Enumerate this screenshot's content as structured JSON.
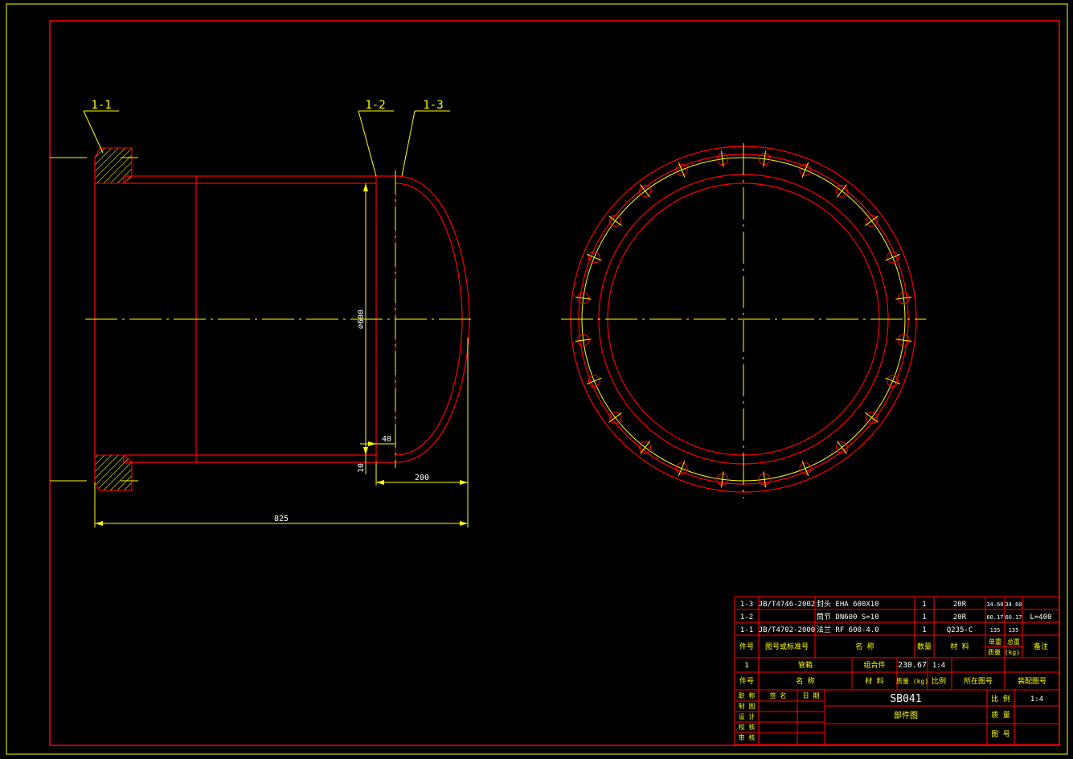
{
  "colors": {
    "outline": "#ff0000",
    "centerline": "#ffff00",
    "dimension": "#ffffff",
    "hatch": "#ffff00",
    "background": "#000000"
  },
  "labels": {
    "p1": "1-1",
    "p2": "1-2",
    "p3": "1-3"
  },
  "dims": {
    "d_600": "∅600",
    "d_40": "40",
    "d_10": "10",
    "d_200": "200",
    "d_825": "825"
  },
  "flange_bolt_count": 24,
  "bom": {
    "rows": [
      {
        "no": "1-3",
        "std": "JB/T4746-2002",
        "name": "封头 EHA 600X10",
        "qty": "1",
        "mat": "20R",
        "w1": "34.60",
        "w2": "34.60",
        "note": ""
      },
      {
        "no": "1-2",
        "std": "",
        "name": "筒节 DN600 S=10",
        "qty": "1",
        "mat": "20R",
        "w1": "60.17",
        "w2": "60.17",
        "note": "L=400"
      },
      {
        "no": "1-1",
        "std": "JB/T4702-2000",
        "name": "法兰 RF 600-4.0",
        "qty": "1",
        "mat": "Q235-C",
        "w1": "135",
        "w2": "135",
        "note": ""
      }
    ],
    "header": {
      "no": "件号",
      "std": "图号或标准号",
      "name": "名   称",
      "qty": "数量",
      "mat": "材 料",
      "w_single": "单重",
      "w_total": "总重",
      "w_unit": "质量 (kg)",
      "note": "备注"
    }
  },
  "assembly": {
    "no": "1",
    "name": "管箱",
    "qty_label": "组合件",
    "weight": "230.67",
    "scale": "1:4",
    "h_no": "件号",
    "h_name": "名   称",
    "h_mat": "材 料",
    "h_weight": "质量 (kg)",
    "h_ratio": "比例",
    "h_draw": "所在图号",
    "h_asm": "装配图号"
  },
  "titleblock": {
    "rows": [
      "职 称",
      "制 图",
      "设 计",
      "校 核",
      "审 核"
    ],
    "sign": "签 名",
    "date": "日 期",
    "drawing_no": "SB041",
    "drawing_name": "部件图",
    "scale_label": "比 例",
    "scale": "1:4",
    "weight_label": "质 量",
    "sheet_label": "图 号"
  }
}
